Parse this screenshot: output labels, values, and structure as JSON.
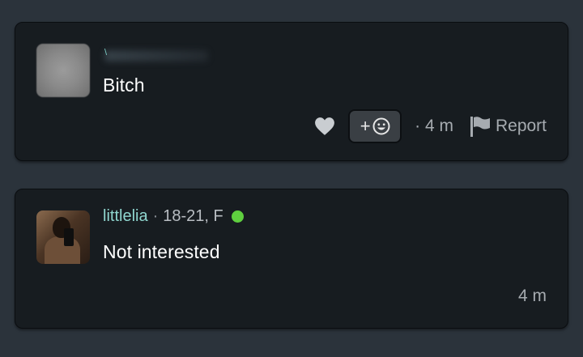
{
  "comments": [
    {
      "author_name": "",
      "author_meta": "",
      "text": "Bitch",
      "time": "· 4 m",
      "react_plus": "+",
      "report_label": "Report"
    },
    {
      "author_name": "littlelia",
      "separator": "·",
      "author_meta": "18-21, F",
      "online": true,
      "text": "Not interested",
      "time": "4 m"
    }
  ],
  "colors": {
    "background": "#2b333b",
    "card": "#171c20",
    "username": "#8fd6cf",
    "online_dot": "#5fcf3f",
    "muted_text": "#a6abb0"
  },
  "icons": [
    "heart-icon",
    "add-reaction-icon",
    "flag-icon",
    "online-status-dot"
  ]
}
